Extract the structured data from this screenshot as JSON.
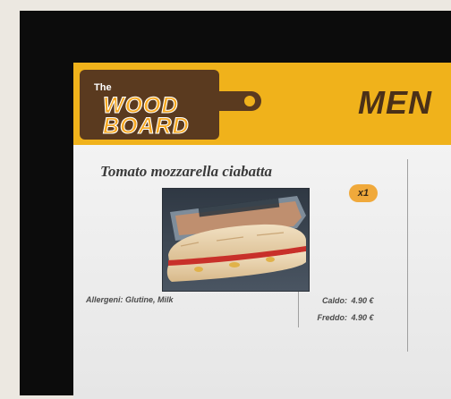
{
  "header": {
    "logo": {
      "the": "The",
      "wood": "WOOD",
      "board": "BOARD"
    },
    "title": "MEN"
  },
  "product": {
    "name": "Tomato mozzarella ciabatta",
    "quantity": "x1",
    "allergens": "Allergeni: Glutine, Milk",
    "prices": [
      {
        "label": "Caldo:",
        "value": "4.90 €"
      },
      {
        "label": "Freddo:",
        "value": "4.90 €"
      }
    ]
  },
  "colors": {
    "header": "#f0b21b",
    "logo_board": "#5a3a1f",
    "menu_text": "#4a3018",
    "badge": "#f0a93b"
  }
}
